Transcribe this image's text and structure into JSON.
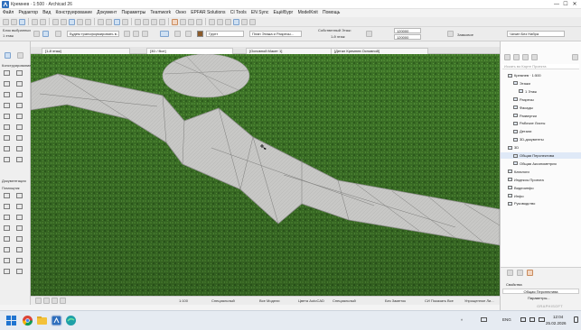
{
  "titlebar": {
    "title": "Кремнев · 1:500 · Archicad 26",
    "controls": [
      "—",
      "☐",
      "✕"
    ]
  },
  "menu": [
    "Файл",
    "Редактор",
    "Вид",
    "Конструирование",
    "Документ",
    "Параметры",
    "Teamwork",
    "Окно",
    "EPFAR Solutions",
    "CI Tools",
    "EN Sync",
    "Ещё/Бург",
    "ModelKnit",
    "Помощь"
  ],
  "toolbar2": {
    "selection_label": "Блок выбранных",
    "elevation_label": "1 этаж",
    "transform_field": "Будем трансформировать в...",
    "material_field": "Грунт",
    "plane_field": "План Этажа и Разрезы...",
    "story_label": "Собственный Этаж:",
    "story_value": "1-й этаж",
    "value_top": "120000",
    "value_bottom": "120000",
    "layer_field": "Замковое",
    "pen_field": "Чичин Без Набра"
  },
  "tabs": [
    "[1-й этаж]",
    "[3D / Все]",
    "[Основной Макет 1]",
    "[Детал Кремнев Основной]"
  ],
  "toolbox": {
    "design_label": "Конструирование",
    "docs_label": "Документация",
    "helpers_label": "Помощник"
  },
  "navigator": {
    "search_placeholder": "Искать во Карте Проекта",
    "items": [
      {
        "label": "Кремнев · 1:500",
        "level": 0,
        "selected": false
      },
      {
        "label": "Этажи",
        "level": 1,
        "selected": false
      },
      {
        "label": "1 Этаж",
        "level": 2,
        "selected": false
      },
      {
        "label": "Разрезы",
        "level": 1,
        "selected": false
      },
      {
        "label": "Фасады",
        "level": 1,
        "selected": false
      },
      {
        "label": "Развертки",
        "level": 1,
        "selected": false
      },
      {
        "label": "Рабочие Листы",
        "level": 1,
        "selected": false
      },
      {
        "label": "Детали",
        "level": 1,
        "selected": false
      },
      {
        "label": "3D-документы",
        "level": 1,
        "selected": false
      },
      {
        "label": "3D",
        "level": 0,
        "selected": false
      },
      {
        "label": "Общая Перспектива",
        "level": 1,
        "selected": true
      },
      {
        "label": "Общая Аксонометрия",
        "level": 1,
        "selected": false
      },
      {
        "label": "Каталоги",
        "level": 0,
        "selected": false
      },
      {
        "label": "Индексы Проекта",
        "level": 0,
        "selected": false
      },
      {
        "label": "Видеоинфо",
        "level": 0,
        "selected": false
      },
      {
        "label": "Инфо",
        "level": 0,
        "selected": false
      },
      {
        "label": "Руководство",
        "level": 0,
        "selected": false
      }
    ],
    "properties_label": "Свойства",
    "view_name": "Общая Перспектива",
    "params_button": "Параметры...",
    "brand": "GRAPHISOFT"
  },
  "statusbar": {
    "items": [
      "1:100",
      "Специальный",
      "Все Модели",
      "Цвета AutoCAD",
      "Специальный",
      "Без Заметок",
      "СИ Показать Все",
      "Упрощенное Ли..."
    ]
  },
  "taskbar": {
    "language": "ENG",
    "time": "12:04",
    "date": "25.02.2026"
  }
}
